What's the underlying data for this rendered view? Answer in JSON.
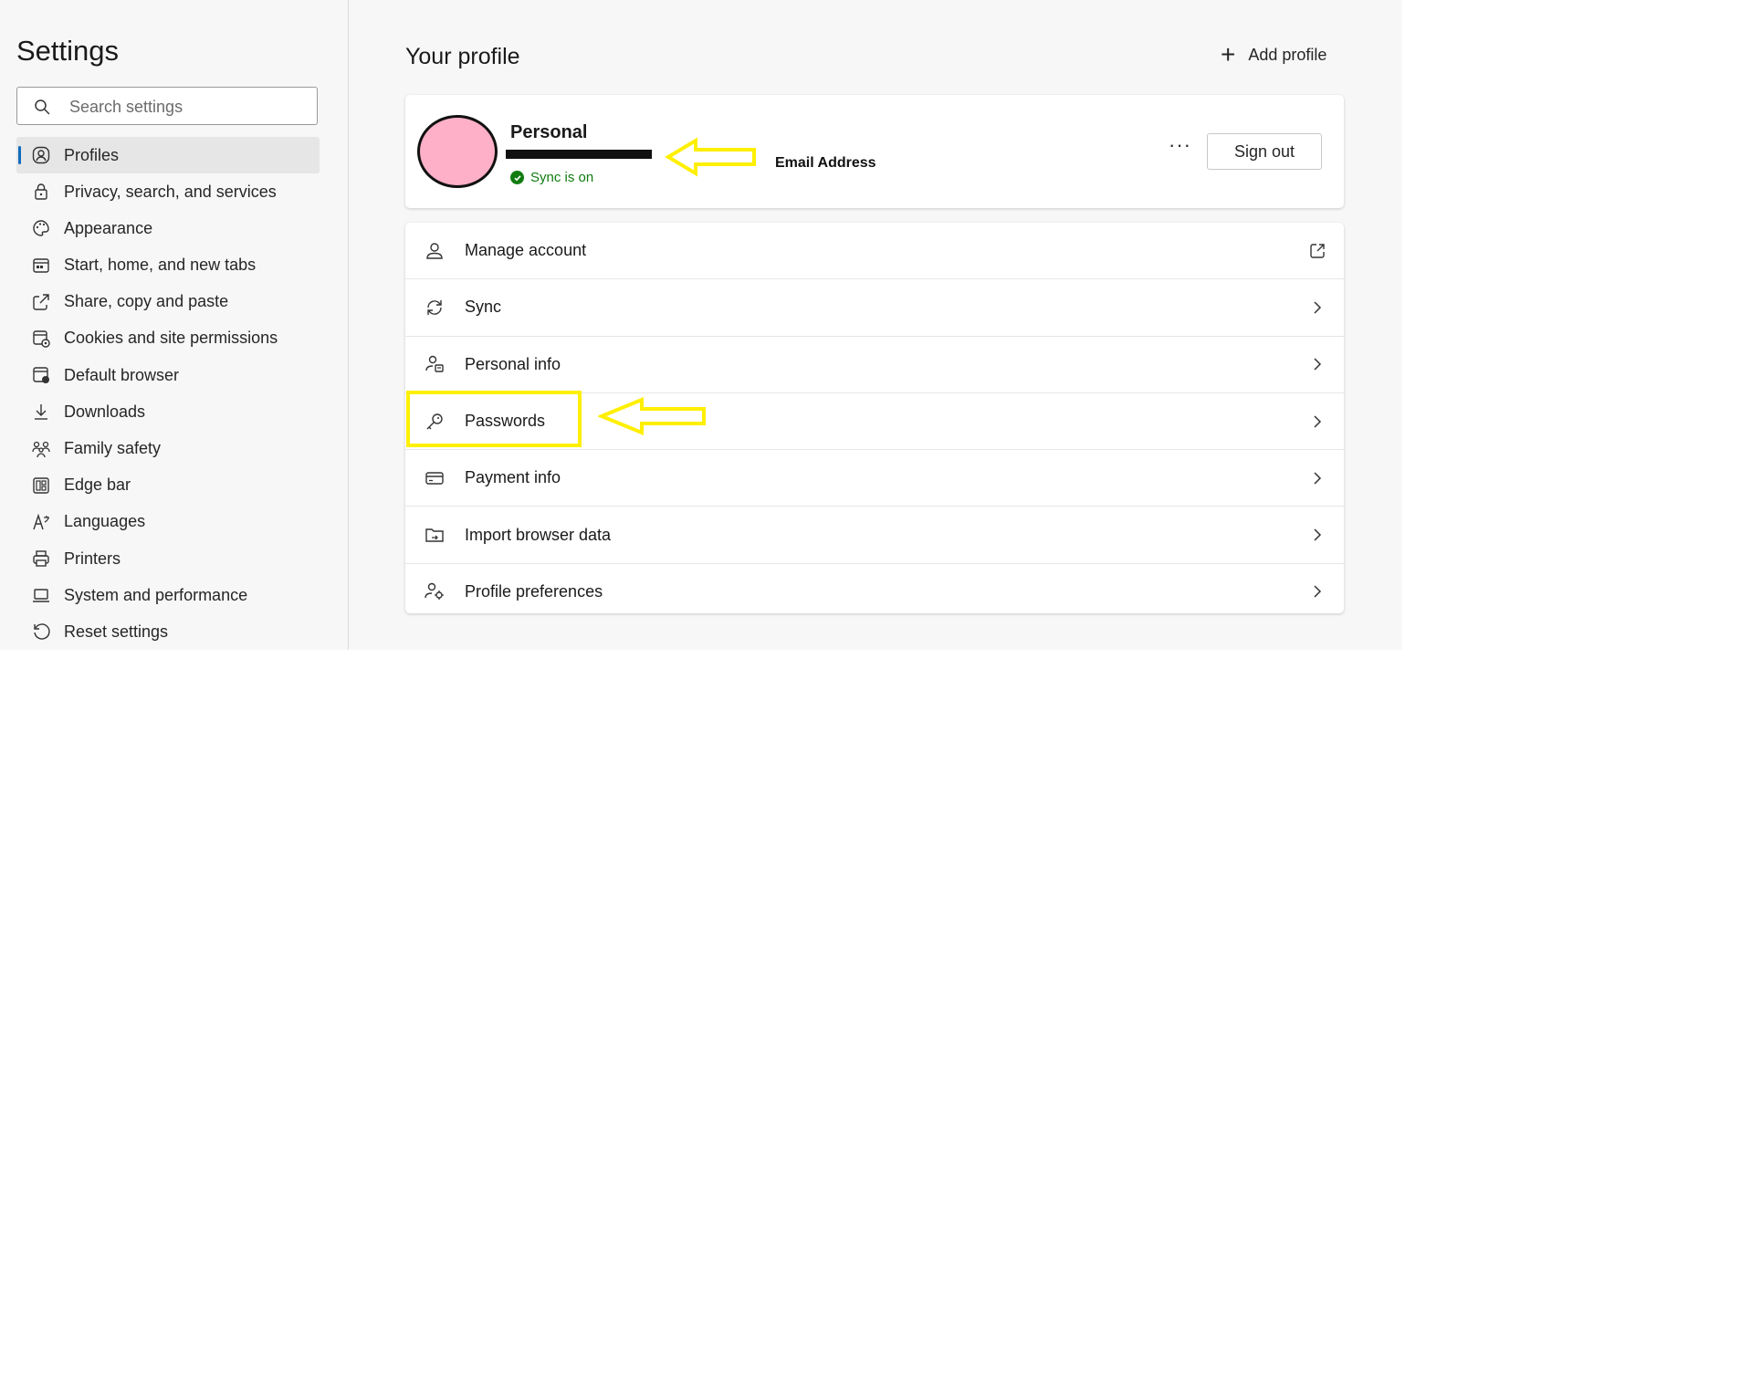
{
  "sidebar": {
    "title": "Settings",
    "search_placeholder": "Search settings",
    "items": [
      {
        "label": "Profiles",
        "icon": "profile-icon",
        "active": true
      },
      {
        "label": "Privacy, search, and services",
        "icon": "lock-icon"
      },
      {
        "label": "Appearance",
        "icon": "palette-icon"
      },
      {
        "label": "Start, home, and new tabs",
        "icon": "home-tabs-icon"
      },
      {
        "label": "Share, copy and paste",
        "icon": "share-icon"
      },
      {
        "label": "Cookies and site permissions",
        "icon": "cookie-permissions-icon"
      },
      {
        "label": "Default browser",
        "icon": "default-browser-icon"
      },
      {
        "label": "Downloads",
        "icon": "download-icon"
      },
      {
        "label": "Family safety",
        "icon": "family-icon"
      },
      {
        "label": "Edge bar",
        "icon": "edge-bar-icon"
      },
      {
        "label": "Languages",
        "icon": "language-icon"
      },
      {
        "label": "Printers",
        "icon": "printer-icon"
      },
      {
        "label": "System and performance",
        "icon": "laptop-icon"
      },
      {
        "label": "Reset settings",
        "icon": "reset-icon"
      }
    ]
  },
  "main": {
    "title": "Your profile",
    "add_profile_label": "Add profile",
    "profile": {
      "name": "Personal",
      "sync_status": "Sync is on",
      "avatar_color": "#fdb0c8",
      "more_label": "···",
      "signout_label": "Sign out"
    },
    "annotations": {
      "email_label": "Email Address",
      "highlight_color": "#ffef00"
    },
    "menu": [
      {
        "label": "Manage account",
        "icon": "person-icon",
        "trailing": "external-link-icon"
      },
      {
        "label": "Sync",
        "icon": "sync-icon",
        "trailing": "chevron-right-icon"
      },
      {
        "label": "Personal info",
        "icon": "personal-info-icon",
        "trailing": "chevron-right-icon"
      },
      {
        "label": "Passwords",
        "icon": "key-icon",
        "trailing": "chevron-right-icon"
      },
      {
        "label": "Payment info",
        "icon": "credit-card-icon",
        "trailing": "chevron-right-icon"
      },
      {
        "label": "Import browser data",
        "icon": "import-folder-icon",
        "trailing": "chevron-right-icon"
      },
      {
        "label": "Profile preferences",
        "icon": "profile-preferences-icon",
        "trailing": "chevron-right-icon"
      }
    ]
  },
  "colors": {
    "accent": "#0f6cbd",
    "sync_green": "#107c10",
    "annotation_yellow": "#ffef00"
  }
}
